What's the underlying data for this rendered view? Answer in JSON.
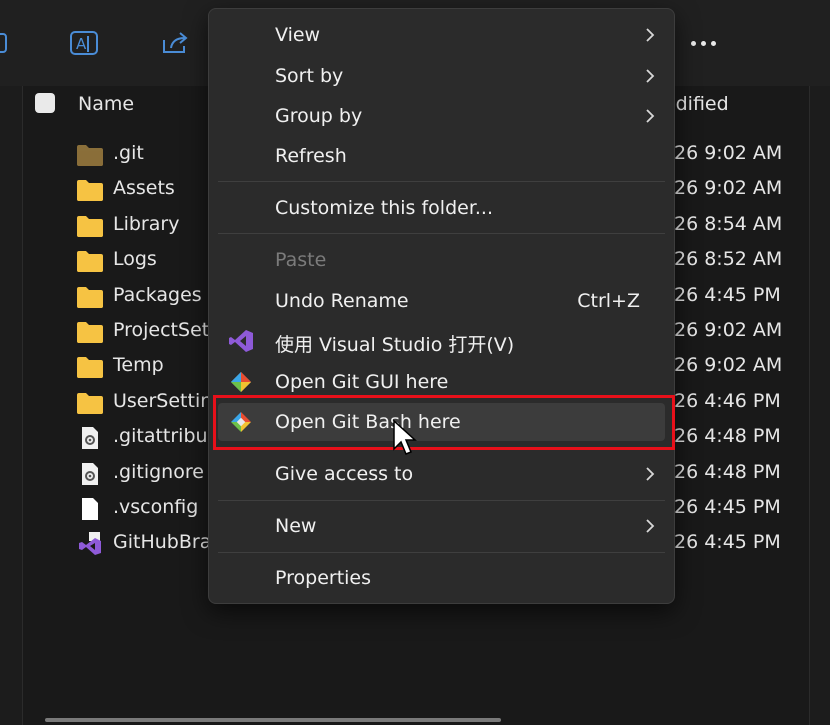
{
  "toolbar": {
    "icons": [
      "translate-icon",
      "share-icon"
    ],
    "more_label": "More options"
  },
  "header": {
    "name": "Name",
    "modified": "odified"
  },
  "files": [
    {
      "name": ".git",
      "date": "26 9:02 AM",
      "icon": "folder-icon",
      "color": "#8a6f3a"
    },
    {
      "name": "Assets",
      "date": "26 9:02 AM",
      "icon": "folder-icon",
      "color": "#f6c343"
    },
    {
      "name": "Library",
      "date": "26 8:54 AM",
      "icon": "folder-icon",
      "color": "#f6c343"
    },
    {
      "name": "Logs",
      "date": "26 8:52 AM",
      "icon": "folder-icon",
      "color": "#f6c343"
    },
    {
      "name": "Packages",
      "date": "26 4:45 PM",
      "icon": "folder-icon",
      "color": "#f6c343"
    },
    {
      "name": "ProjectSet",
      "date": "26 9:02 AM",
      "icon": "folder-icon",
      "color": "#f6c343"
    },
    {
      "name": "Temp",
      "date": "26 9:02 AM",
      "icon": "folder-icon",
      "color": "#f6c343"
    },
    {
      "name": "UserSettir",
      "date": "26 4:46 PM",
      "icon": "folder-icon",
      "color": "#f6c343"
    },
    {
      "name": ".gitattribu",
      "date": "26 4:48 PM",
      "icon": "settings-file-icon",
      "color": "#e0e0e0"
    },
    {
      "name": ".gitignore",
      "date": "26 4:48 PM",
      "icon": "settings-file-icon",
      "color": "#e0e0e0"
    },
    {
      "name": ".vsconfig",
      "date": "26 4:45 PM",
      "icon": "file-icon",
      "color": "#ffffff"
    },
    {
      "name": "GitHubBra",
      "date": "26 4:45 PM",
      "icon": "visual-studio-solution-icon",
      "color": "#8e5ad8"
    }
  ],
  "menu": {
    "view": "View",
    "sort_by": "Sort by",
    "group_by": "Group by",
    "refresh": "Refresh",
    "customize": "Customize this folder...",
    "paste": "Paste",
    "undo_rename": "Undo Rename",
    "undo_shortcut": "Ctrl+Z",
    "open_vs": "使用 Visual Studio 打开(V)",
    "open_git_gui": "Open Git GUI here",
    "open_git_bash": "Open Git Bash here",
    "give_access": "Give access to",
    "new": "New",
    "properties": "Properties"
  },
  "colors": {
    "highlight": "#e8101a",
    "menu_bg": "#2b2b2b",
    "hover_bg": "#3c3c3c",
    "vs_purple": "#8e5ad8"
  }
}
